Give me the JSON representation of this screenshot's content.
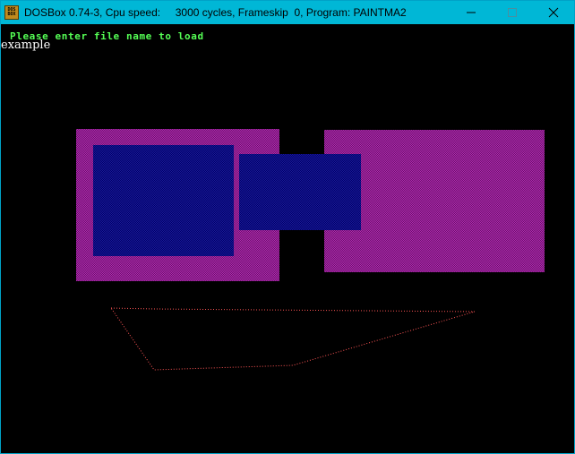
{
  "window": {
    "title": "DOSBox 0.74-3, Cpu speed:     3000 cycles, Frameskip  0, Program: PAINTMA2",
    "icon_label_top": "DOS",
    "icon_label_bottom": "BOX"
  },
  "screen": {
    "prompt": "Please enter file name to load",
    "input_value": "example"
  },
  "colors": {
    "titlebar": "#00b7d6",
    "prompt_text": "#55ff55",
    "magenta_fill": "#8a1f8a",
    "blue_fill": "#0a0a7a",
    "polygon_outline": "#ff5555"
  }
}
